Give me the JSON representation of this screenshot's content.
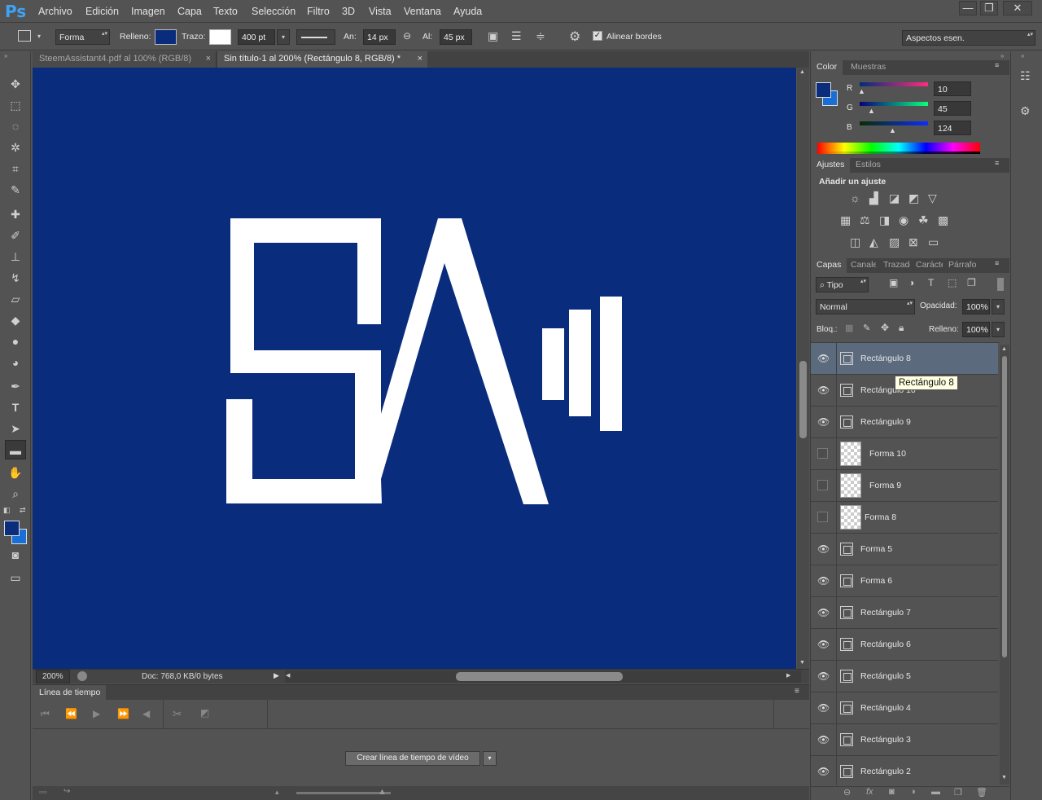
{
  "app": {
    "logo": "Ps"
  },
  "menu": [
    "Archivo",
    "Edición",
    "Imagen",
    "Capa",
    "Texto",
    "Selección",
    "Filtro",
    "3D",
    "Vista",
    "Ventana",
    "Ayuda"
  ],
  "window_controls": {
    "minimize": "—",
    "restore": "❐",
    "close": "✕"
  },
  "options": {
    "shape_mode": "Forma",
    "fill_label": "Relleno:",
    "stroke_label": "Trazo:",
    "stroke_size": "400 pt",
    "width_label": "An:",
    "width_value": "14 px",
    "height_label": "Al:",
    "height_value": "45 px",
    "align_edges": "Alinear bordes",
    "workspace": "Aspectos esen.",
    "fill_color": "#0a2c7c",
    "stroke_color": "#ffffff"
  },
  "doc_tabs": [
    {
      "label": "SteemAssistant4.pdf al 100% (RGB/8)"
    },
    {
      "label": "Sin título-1 al 200% (Rectángulo 8, RGB/8) *"
    }
  ],
  "status": {
    "zoom": "200%",
    "doc": "Doc: 768,0 KB/0 bytes"
  },
  "timeline": {
    "title": "Línea de tiempo",
    "create_button": "Crear línea de tiempo de vídeo"
  },
  "color_panel": {
    "tabs": [
      "Color",
      "Muestras"
    ],
    "r_label": "R",
    "g_label": "G",
    "b_label": "B",
    "r": "10",
    "g": "45",
    "b": "124",
    "fg": "#0a2d7c",
    "bg": "#1a6fd6"
  },
  "adjust_panel": {
    "tabs": [
      "Ajustes",
      "Estilos"
    ],
    "title": "Añadir un ajuste"
  },
  "layers_panel": {
    "tabs": [
      "Capas",
      "Canales",
      "Trazados",
      "Carácter",
      "Párrafo"
    ],
    "filter": "Tipo",
    "blend_mode": "Normal",
    "opacity_label": "Opacidad:",
    "opacity": "100%",
    "lock_label": "Bloq.:",
    "fill_label": "Relleno:",
    "fill": "100%",
    "tooltip": "Rectángulo 8",
    "layers": [
      {
        "name": "Rectángulo 8",
        "visible": true,
        "kind": "shape",
        "selected": true
      },
      {
        "name": "Rectángulo 10",
        "visible": true,
        "kind": "shape"
      },
      {
        "name": "Rectángulo 9",
        "visible": true,
        "kind": "shape"
      },
      {
        "name": "Forma 10",
        "visible": false,
        "kind": "raster"
      },
      {
        "name": "Forma 9",
        "visible": false,
        "kind": "raster"
      },
      {
        "name": "Forma 8",
        "visible": false,
        "kind": "raster"
      },
      {
        "name": "Forma 5",
        "visible": true,
        "kind": "shape"
      },
      {
        "name": "Forma 6",
        "visible": true,
        "kind": "shape"
      },
      {
        "name": "Rectángulo 7",
        "visible": true,
        "kind": "shape"
      },
      {
        "name": "Rectángulo 6",
        "visible": true,
        "kind": "shape"
      },
      {
        "name": "Rectángulo 5",
        "visible": true,
        "kind": "shape"
      },
      {
        "name": "Rectángulo 4",
        "visible": true,
        "kind": "shape"
      },
      {
        "name": "Rectángulo 3",
        "visible": true,
        "kind": "shape"
      },
      {
        "name": "Rectángulo 2",
        "visible": true,
        "kind": "shape"
      }
    ]
  },
  "canvas": {
    "background": "#0a2c7c",
    "shape_color": "#ffffff"
  }
}
